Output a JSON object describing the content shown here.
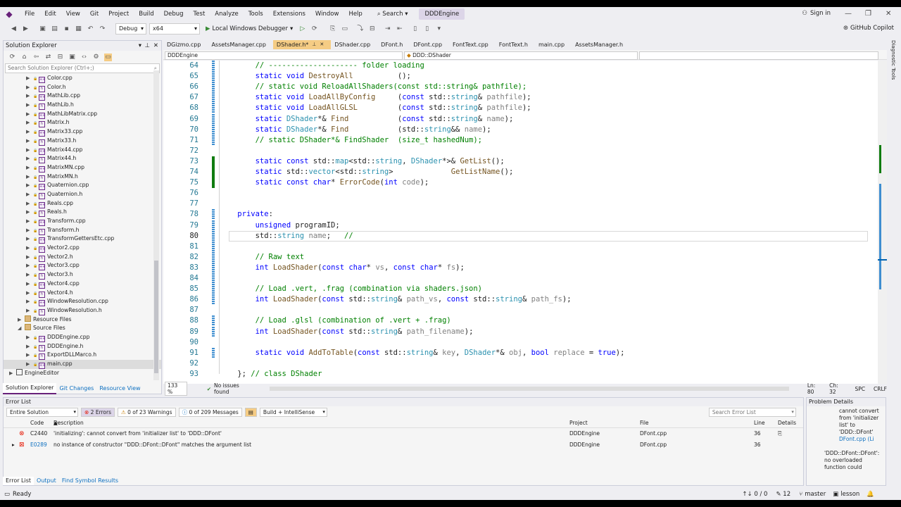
{
  "menu": [
    "File",
    "Edit",
    "View",
    "Git",
    "Project",
    "Build",
    "Debug",
    "Test",
    "Analyze",
    "Tools",
    "Extensions",
    "Window",
    "Help"
  ],
  "search_label": "Search",
  "solution_name": "DDDEngine",
  "sign_in": "Sign in",
  "toolbar": {
    "config": "Debug",
    "platform": "x64",
    "debugger": "Local Windows Debugger"
  },
  "copilot": "GitHub Copilot",
  "solution_explorer": {
    "title": "Solution Explorer",
    "search_placeholder": "Search Solution Explorer (Ctrl+;)",
    "items": [
      {
        "label": "Color.cpp",
        "type": "cpp",
        "depth": 2
      },
      {
        "label": "Color.h",
        "type": "h",
        "depth": 2
      },
      {
        "label": "MathLib.cpp",
        "type": "cpp",
        "depth": 2
      },
      {
        "label": "MathLib.h",
        "type": "h",
        "depth": 2
      },
      {
        "label": "MathLibMatrix.cpp",
        "type": "cpp",
        "depth": 2
      },
      {
        "label": "Matrix.h",
        "type": "h",
        "depth": 2
      },
      {
        "label": "Matrix33.cpp",
        "type": "cpp",
        "depth": 2
      },
      {
        "label": "Matrix33.h",
        "type": "h",
        "depth": 2
      },
      {
        "label": "Matrix44.cpp",
        "type": "cpp",
        "depth": 2
      },
      {
        "label": "Matrix44.h",
        "type": "h",
        "depth": 2
      },
      {
        "label": "MatrixMN.cpp",
        "type": "cpp",
        "depth": 2
      },
      {
        "label": "MatrixMN.h",
        "type": "h",
        "depth": 2
      },
      {
        "label": "Quaternion.cpp",
        "type": "cpp",
        "depth": 2
      },
      {
        "label": "Quaternion.h",
        "type": "h",
        "depth": 2
      },
      {
        "label": "Reals.cpp",
        "type": "cpp",
        "depth": 2
      },
      {
        "label": "Reals.h",
        "type": "h",
        "depth": 2
      },
      {
        "label": "Transform.cpp",
        "type": "cpp",
        "depth": 2
      },
      {
        "label": "Transform.h",
        "type": "h",
        "depth": 2
      },
      {
        "label": "TransformGettersEtc.cpp",
        "type": "cpp",
        "depth": 2
      },
      {
        "label": "Vector2.cpp",
        "type": "cpp",
        "depth": 2
      },
      {
        "label": "Vector2.h",
        "type": "h",
        "depth": 2
      },
      {
        "label": "Vector3.cpp",
        "type": "cpp",
        "depth": 2
      },
      {
        "label": "Vector3.h",
        "type": "h",
        "depth": 2
      },
      {
        "label": "Vector4.cpp",
        "type": "cpp",
        "depth": 2
      },
      {
        "label": "Vector4.h",
        "type": "h",
        "depth": 2
      },
      {
        "label": "WindowResolution.cpp",
        "type": "cpp",
        "depth": 2
      },
      {
        "label": "WindowResolution.h",
        "type": "h",
        "depth": 2
      },
      {
        "label": "Resource Files",
        "type": "folder",
        "depth": 1
      },
      {
        "label": "Source Files",
        "type": "folder",
        "depth": 1,
        "open": true
      },
      {
        "label": "DDDEngine.cpp",
        "type": "cpp",
        "depth": 2
      },
      {
        "label": "DDDEngine.h",
        "type": "h",
        "depth": 2
      },
      {
        "label": "ExportDLLMarco.h",
        "type": "h",
        "depth": 2
      },
      {
        "label": "main.cpp",
        "type": "cpp",
        "depth": 2,
        "selected": true
      },
      {
        "label": "EngineEditor",
        "type": "project",
        "depth": 0
      }
    ],
    "tabs": [
      "Solution Explorer",
      "Git Changes",
      "Resource View"
    ]
  },
  "editor": {
    "tabs": [
      "DGizmo.cpp",
      "AssetsManager.cpp",
      "DShader.h*",
      "DShader.cpp",
      "DFont.h",
      "DFont.cpp",
      "FontText.cpp",
      "FontText.h",
      "main.cpp",
      "AssetsManager.h"
    ],
    "active_tab": "DShader.h*",
    "nav_project": "DDDEngine",
    "nav_scope": "DDD::DShader",
    "zoom": "133 %",
    "issues": "No issues found",
    "cursor": "Ln: 80",
    "col": "Ch: 32",
    "ws": "SPC",
    "eol": "CRLF",
    "lines": [
      {
        "n": "64",
        "t": "        // -------------------- folder loading"
      },
      {
        "n": "65",
        "t": "        static void DestroyAll          ();"
      },
      {
        "n": "66",
        "t": "        // static void ReloadAllShaders(const std::string& pathfile);"
      },
      {
        "n": "67",
        "t": "        static void LoadAllByConfig     (const std::string& pathfile);"
      },
      {
        "n": "68",
        "t": "        static void LoadAllGLSL         (const std::string& pathfile);"
      },
      {
        "n": "69",
        "t": "        static DShader*& Find           (const std::string& name);"
      },
      {
        "n": "70",
        "t": "        static DShader*& Find           (std::string&& name);"
      },
      {
        "n": "71",
        "t": "        // static DShader*& FindShader  (size_t hashedNum);"
      },
      {
        "n": "72",
        "t": ""
      },
      {
        "n": "73",
        "t": "        static const std::map<std::string, DShader*>& GetList();"
      },
      {
        "n": "74",
        "t": "        static std::vector<std::string>             GetListName();"
      },
      {
        "n": "75",
        "t": "        static const char* ErrorCode(int code);"
      },
      {
        "n": "76",
        "t": ""
      },
      {
        "n": "77",
        "t": ""
      },
      {
        "n": "78",
        "t": "    private:"
      },
      {
        "n": "79",
        "t": "        unsigned programID;"
      },
      {
        "n": "80",
        "t": "        std::string name;   // "
      },
      {
        "n": "81",
        "t": ""
      },
      {
        "n": "82",
        "t": "        // Raw text"
      },
      {
        "n": "83",
        "t": "        int LoadShader(const char* vs, const char* fs);"
      },
      {
        "n": "84",
        "t": ""
      },
      {
        "n": "85",
        "t": "        // Load .vert, .frag (combination via shaders.json)"
      },
      {
        "n": "86",
        "t": "        int LoadShader(const std::string& path_vs, const std::string& path_fs);"
      },
      {
        "n": "87",
        "t": ""
      },
      {
        "n": "88",
        "t": "        // Load .glsl (combination of .vert + .frag)"
      },
      {
        "n": "89",
        "t": "        int LoadShader(const std::string& path_filename);"
      },
      {
        "n": "90",
        "t": ""
      },
      {
        "n": "91",
        "t": "        static void AddToTable(const std::string& key, DShader*& obj, bool replace = true);"
      },
      {
        "n": "92",
        "t": ""
      },
      {
        "n": "93",
        "t": "    }; // class DShader"
      }
    ]
  },
  "error_list": {
    "title": "Error List",
    "scope": "Entire Solution",
    "errors_badge": "2 Errors",
    "warnings_badge": "0 of 23 Warnings",
    "messages_badge": "0 of 209 Messages",
    "build_filter": "Build + IntelliSense",
    "search_placeholder": "Search Error List",
    "headers": [
      "Code",
      "Description",
      "Project",
      "File",
      "Line",
      "Details"
    ],
    "rows": [
      {
        "code": "C2440",
        "desc": "'initializing': cannot convert from 'initializer list' to 'DDD::DFont'",
        "project": "DDDEngine",
        "file": "DFont.cpp",
        "line": "36"
      },
      {
        "code": "E0289",
        "desc": "no instance of constructor \"DDD::DFont::DFont\" matches the argument list",
        "project": "DDDEngine",
        "file": "DFont.cpp",
        "line": "36"
      }
    ],
    "tabs": [
      "Error List",
      "Output",
      "Find Symbol Results"
    ]
  },
  "problem_details": {
    "title": "Problem Details",
    "text1": "cannot convert from 'initializer list' to 'DDD::DFont'",
    "link": "DFont.cpp (Li",
    "text2": "'DDD::DFont::DFont': no overloaded function could"
  },
  "right_strip": "Diagnostic Tools",
  "status": {
    "ready": "Ready",
    "updown": "0 / 0",
    "pencil_count": "12",
    "branch": "master",
    "repo": "lesson"
  }
}
